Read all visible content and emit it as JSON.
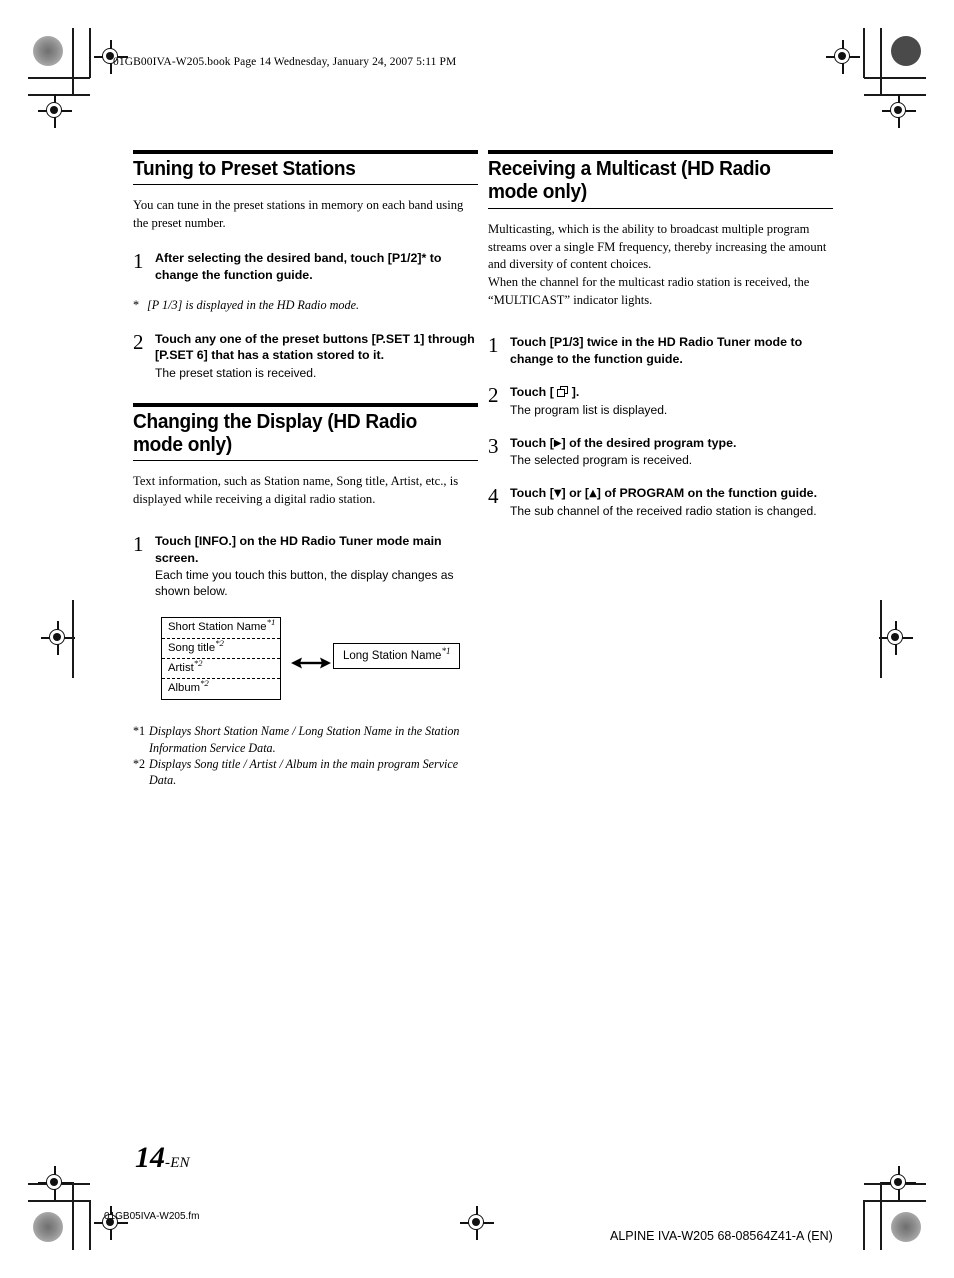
{
  "running_head": "01GB00IVA-W205.book  Page 14  Wednesday, January 24, 2007  5:11 PM",
  "footer": {
    "left_file": "01GB05IVA-W205.fm",
    "right_id": "ALPINE IVA-W205 68-08564Z41-A (EN)"
  },
  "page_number": {
    "number": "14",
    "suffix": "-EN"
  },
  "left_column": {
    "section1": {
      "heading": "Tuning to Preset Stations",
      "intro": "You can tune in the preset stations in memory on each band using the preset number.",
      "steps": [
        {
          "num": "1",
          "title_pre": "After selecting the desired band, touch ",
          "title_key": "[P1/2]",
          "title_post": "* to change the function guide.",
          "sub": ""
        },
        {
          "num": "2",
          "title_pre": "Touch any one of the preset buttons ",
          "title_key": "[P.SET 1]",
          "title_mid": " through ",
          "title_key2": "[P.SET 6]",
          "title_post": " that has a station stored to it.",
          "sub": "The preset station is received."
        }
      ],
      "note": {
        "mark": "*",
        "text": "[P 1/3] is displayed in the HD Radio mode."
      }
    },
    "section2": {
      "heading": "Changing the Display (HD Radio mode only)",
      "intro": "Text information, such as Station name, Song title, Artist, etc., is displayed while receiving a digital radio station.",
      "steps": [
        {
          "num": "1",
          "title_pre": "Touch ",
          "title_key": "[INFO.]",
          "title_post": " on the HD Radio Tuner mode main screen.",
          "sub": "Each time you touch this button, the display changes as shown below."
        }
      ],
      "diagram": {
        "stack": [
          {
            "label": "Short Station Name",
            "footnote": "*1"
          },
          {
            "label": "Song title",
            "footnote": "*2"
          },
          {
            "label": "Artist",
            "footnote": "*2"
          },
          {
            "label": "Album",
            "footnote": "*2"
          }
        ],
        "arrow": "double-headed-arrow",
        "target": {
          "label": "Long Station Name",
          "footnote": "*1"
        }
      },
      "footnotes": [
        {
          "mark": "*1",
          "text": "Displays Short Station Name / Long Station Name in the Station Information Service Data."
        },
        {
          "mark": "*2",
          "text": "Displays Song title / Artist / Album in the main program Service Data."
        }
      ]
    }
  },
  "right_column": {
    "section1": {
      "heading": "Receiving a Multicast (HD Radio mode only)",
      "intro_p1": "Multicasting, which is the ability to broadcast multiple program streams over a single FM frequency, thereby increasing the amount and diversity of content choices.",
      "intro_p2": "When the channel for the multicast radio station is received, the “MULTICAST” indicator lights.",
      "steps": [
        {
          "num": "1",
          "title_pre": "Touch ",
          "title_key": "[P1/3]",
          "title_post": " twice in the HD Radio Tuner mode to change to the function guide.",
          "sub": ""
        },
        {
          "num": "2",
          "title_pre": "Touch [ ",
          "title_icon": "stacked-pages-icon",
          "title_post": " ].",
          "sub": "The program list is displayed."
        },
        {
          "num": "3",
          "title_pre": "Touch [",
          "title_glyph": "▶",
          "title_post": "] of the desired program type.",
          "sub": "The selected program is received."
        },
        {
          "num": "4",
          "title_pre": "Touch [",
          "title_glyph": "▼",
          "title_mid": "] or [",
          "title_glyph2": "▲",
          "title_post": "] of PROGRAM on the function guide.",
          "sub": "The sub channel of the received radio station is changed."
        }
      ]
    }
  }
}
